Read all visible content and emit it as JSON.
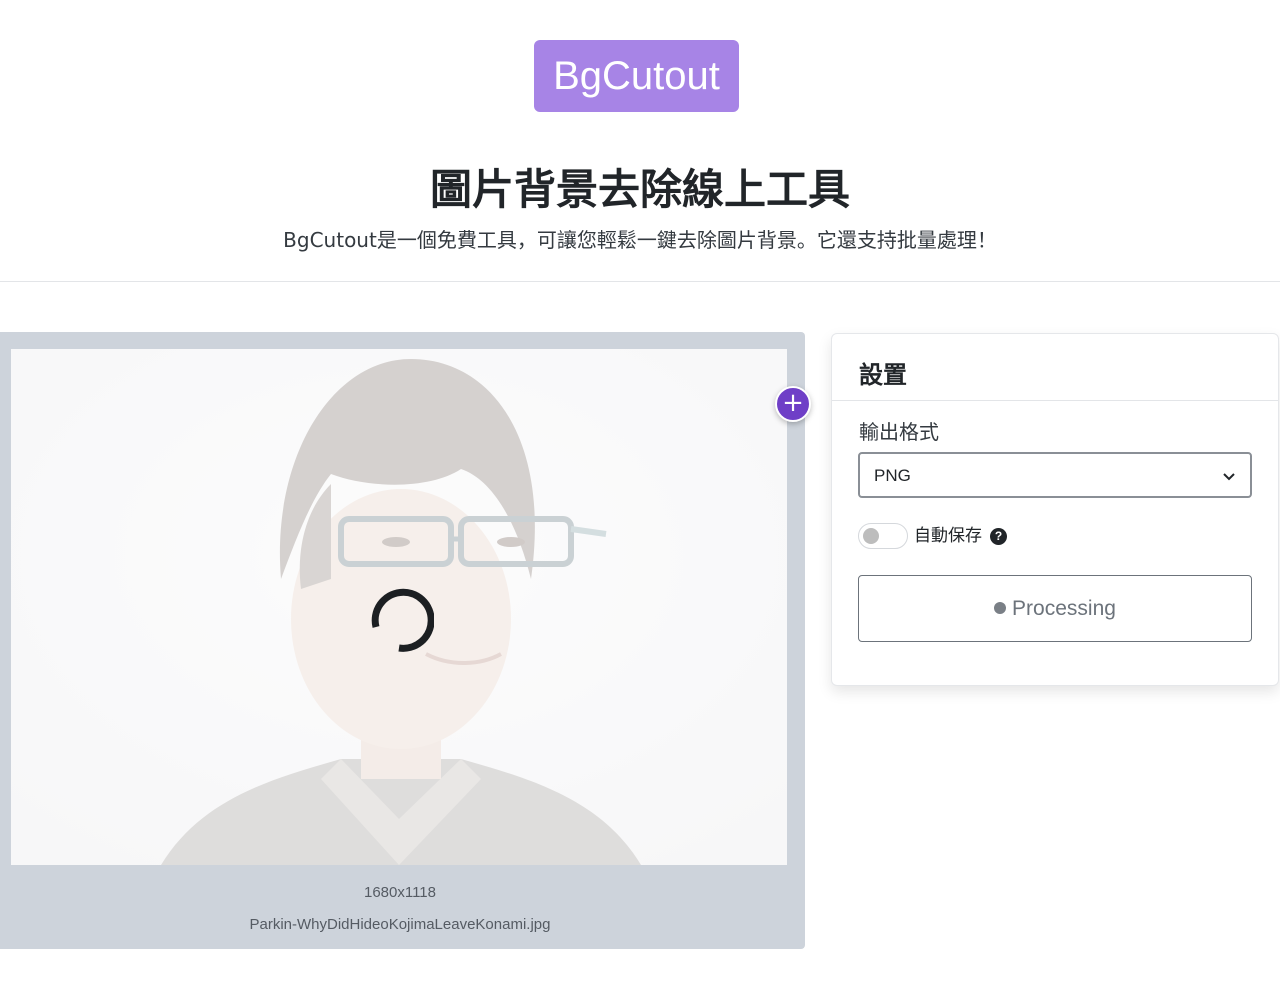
{
  "header": {
    "logo_text": "BgCutout",
    "title": "圖片背景去除線上工具",
    "subtitle": "BgCutout是一個免費工具，可讓您輕鬆一鍵去除圖片背景。它還支持批量處理！"
  },
  "preview": {
    "add_label": "+",
    "image_dimensions": "1680x1118",
    "file_name": "Parkin-WhyDidHideoKojimaLeaveKonami.jpg",
    "status": "loading"
  },
  "settings": {
    "title": "設置",
    "output_format_label": "輸出格式",
    "output_format_value": "PNG",
    "auto_save_label": "自動保存",
    "auto_save_enabled": false,
    "help_label": "?",
    "process_button_label": "Processing"
  },
  "colors": {
    "brand": "#a784e6",
    "accent": "#6f3fc7",
    "panel_bg": "#cdd3db"
  }
}
